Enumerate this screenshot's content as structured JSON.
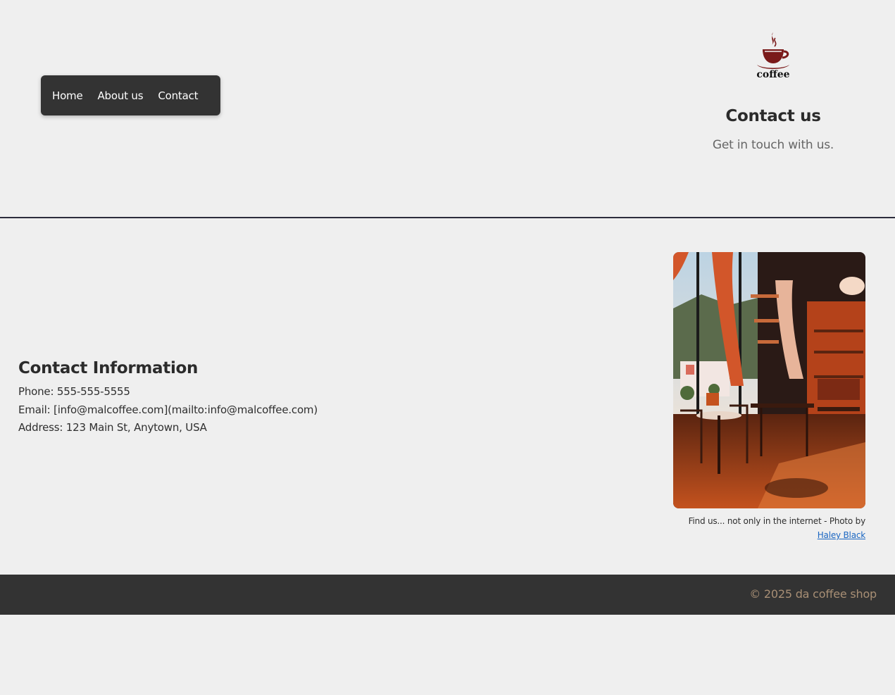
{
  "nav": {
    "items": [
      "Home",
      "About us",
      "Contact"
    ]
  },
  "brand": {
    "logo_text": "coffee",
    "logo_icon": "coffee-cup-icon",
    "logo_color": "#7a1a1a"
  },
  "header": {
    "title": "Contact us",
    "subtitle": "Get in touch with us."
  },
  "contact": {
    "heading": "Contact Information",
    "phone": "Phone: 555-555-5555",
    "email": "Email: [info@malcoffee.com](mailto:info@malcoffee.com)",
    "address": "Address: 123 Main St, Anytown, USA"
  },
  "photo": {
    "alt": "coffee shop interior",
    "caption_prefix": "Find us... not only in the internet - Photo by",
    "credit_link": "Haley Black"
  },
  "footer": {
    "copyright": "© 2025 da coffee shop"
  },
  "colors": {
    "background": "#efefef",
    "nav_bg": "#333333",
    "footer_text": "#a88f75",
    "link": "#1a66c2"
  }
}
